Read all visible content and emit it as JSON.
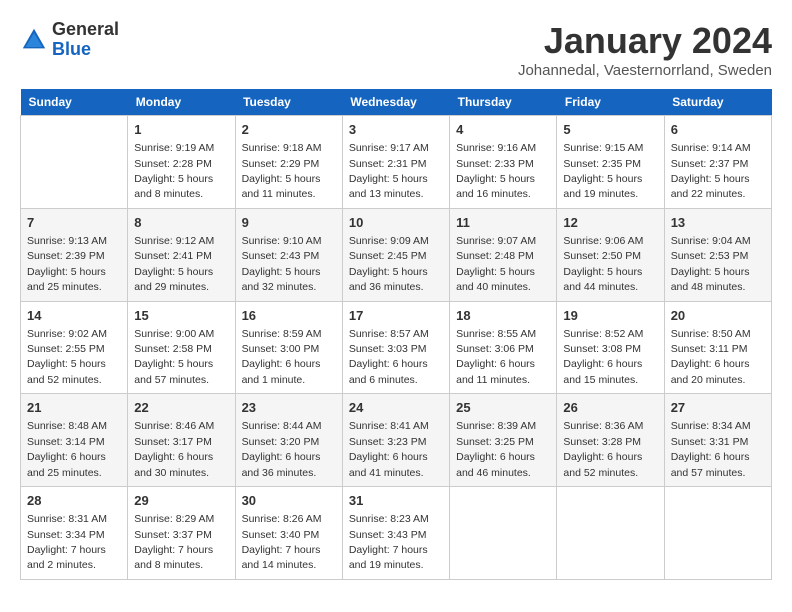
{
  "header": {
    "logo_general": "General",
    "logo_blue": "Blue",
    "month_title": "January 2024",
    "subtitle": "Johannedal, Vaesternorrland, Sweden"
  },
  "weekdays": [
    "Sunday",
    "Monday",
    "Tuesday",
    "Wednesday",
    "Thursday",
    "Friday",
    "Saturday"
  ],
  "weeks": [
    [
      {
        "day": "",
        "sunrise": "",
        "sunset": "",
        "daylight": ""
      },
      {
        "day": "1",
        "sunrise": "Sunrise: 9:19 AM",
        "sunset": "Sunset: 2:28 PM",
        "daylight": "Daylight: 5 hours and 8 minutes."
      },
      {
        "day": "2",
        "sunrise": "Sunrise: 9:18 AM",
        "sunset": "Sunset: 2:29 PM",
        "daylight": "Daylight: 5 hours and 11 minutes."
      },
      {
        "day": "3",
        "sunrise": "Sunrise: 9:17 AM",
        "sunset": "Sunset: 2:31 PM",
        "daylight": "Daylight: 5 hours and 13 minutes."
      },
      {
        "day": "4",
        "sunrise": "Sunrise: 9:16 AM",
        "sunset": "Sunset: 2:33 PM",
        "daylight": "Daylight: 5 hours and 16 minutes."
      },
      {
        "day": "5",
        "sunrise": "Sunrise: 9:15 AM",
        "sunset": "Sunset: 2:35 PM",
        "daylight": "Daylight: 5 hours and 19 minutes."
      },
      {
        "day": "6",
        "sunrise": "Sunrise: 9:14 AM",
        "sunset": "Sunset: 2:37 PM",
        "daylight": "Daylight: 5 hours and 22 minutes."
      }
    ],
    [
      {
        "day": "7",
        "sunrise": "Sunrise: 9:13 AM",
        "sunset": "Sunset: 2:39 PM",
        "daylight": "Daylight: 5 hours and 25 minutes."
      },
      {
        "day": "8",
        "sunrise": "Sunrise: 9:12 AM",
        "sunset": "Sunset: 2:41 PM",
        "daylight": "Daylight: 5 hours and 29 minutes."
      },
      {
        "day": "9",
        "sunrise": "Sunrise: 9:10 AM",
        "sunset": "Sunset: 2:43 PM",
        "daylight": "Daylight: 5 hours and 32 minutes."
      },
      {
        "day": "10",
        "sunrise": "Sunrise: 9:09 AM",
        "sunset": "Sunset: 2:45 PM",
        "daylight": "Daylight: 5 hours and 36 minutes."
      },
      {
        "day": "11",
        "sunrise": "Sunrise: 9:07 AM",
        "sunset": "Sunset: 2:48 PM",
        "daylight": "Daylight: 5 hours and 40 minutes."
      },
      {
        "day": "12",
        "sunrise": "Sunrise: 9:06 AM",
        "sunset": "Sunset: 2:50 PM",
        "daylight": "Daylight: 5 hours and 44 minutes."
      },
      {
        "day": "13",
        "sunrise": "Sunrise: 9:04 AM",
        "sunset": "Sunset: 2:53 PM",
        "daylight": "Daylight: 5 hours and 48 minutes."
      }
    ],
    [
      {
        "day": "14",
        "sunrise": "Sunrise: 9:02 AM",
        "sunset": "Sunset: 2:55 PM",
        "daylight": "Daylight: 5 hours and 52 minutes."
      },
      {
        "day": "15",
        "sunrise": "Sunrise: 9:00 AM",
        "sunset": "Sunset: 2:58 PM",
        "daylight": "Daylight: 5 hours and 57 minutes."
      },
      {
        "day": "16",
        "sunrise": "Sunrise: 8:59 AM",
        "sunset": "Sunset: 3:00 PM",
        "daylight": "Daylight: 6 hours and 1 minute."
      },
      {
        "day": "17",
        "sunrise": "Sunrise: 8:57 AM",
        "sunset": "Sunset: 3:03 PM",
        "daylight": "Daylight: 6 hours and 6 minutes."
      },
      {
        "day": "18",
        "sunrise": "Sunrise: 8:55 AM",
        "sunset": "Sunset: 3:06 PM",
        "daylight": "Daylight: 6 hours and 11 minutes."
      },
      {
        "day": "19",
        "sunrise": "Sunrise: 8:52 AM",
        "sunset": "Sunset: 3:08 PM",
        "daylight": "Daylight: 6 hours and 15 minutes."
      },
      {
        "day": "20",
        "sunrise": "Sunrise: 8:50 AM",
        "sunset": "Sunset: 3:11 PM",
        "daylight": "Daylight: 6 hours and 20 minutes."
      }
    ],
    [
      {
        "day": "21",
        "sunrise": "Sunrise: 8:48 AM",
        "sunset": "Sunset: 3:14 PM",
        "daylight": "Daylight: 6 hours and 25 minutes."
      },
      {
        "day": "22",
        "sunrise": "Sunrise: 8:46 AM",
        "sunset": "Sunset: 3:17 PM",
        "daylight": "Daylight: 6 hours and 30 minutes."
      },
      {
        "day": "23",
        "sunrise": "Sunrise: 8:44 AM",
        "sunset": "Sunset: 3:20 PM",
        "daylight": "Daylight: 6 hours and 36 minutes."
      },
      {
        "day": "24",
        "sunrise": "Sunrise: 8:41 AM",
        "sunset": "Sunset: 3:23 PM",
        "daylight": "Daylight: 6 hours and 41 minutes."
      },
      {
        "day": "25",
        "sunrise": "Sunrise: 8:39 AM",
        "sunset": "Sunset: 3:25 PM",
        "daylight": "Daylight: 6 hours and 46 minutes."
      },
      {
        "day": "26",
        "sunrise": "Sunrise: 8:36 AM",
        "sunset": "Sunset: 3:28 PM",
        "daylight": "Daylight: 6 hours and 52 minutes."
      },
      {
        "day": "27",
        "sunrise": "Sunrise: 8:34 AM",
        "sunset": "Sunset: 3:31 PM",
        "daylight": "Daylight: 6 hours and 57 minutes."
      }
    ],
    [
      {
        "day": "28",
        "sunrise": "Sunrise: 8:31 AM",
        "sunset": "Sunset: 3:34 PM",
        "daylight": "Daylight: 7 hours and 2 minutes."
      },
      {
        "day": "29",
        "sunrise": "Sunrise: 8:29 AM",
        "sunset": "Sunset: 3:37 PM",
        "daylight": "Daylight: 7 hours and 8 minutes."
      },
      {
        "day": "30",
        "sunrise": "Sunrise: 8:26 AM",
        "sunset": "Sunset: 3:40 PM",
        "daylight": "Daylight: 7 hours and 14 minutes."
      },
      {
        "day": "31",
        "sunrise": "Sunrise: 8:23 AM",
        "sunset": "Sunset: 3:43 PM",
        "daylight": "Daylight: 7 hours and 19 minutes."
      },
      {
        "day": "",
        "sunrise": "",
        "sunset": "",
        "daylight": ""
      },
      {
        "day": "",
        "sunrise": "",
        "sunset": "",
        "daylight": ""
      },
      {
        "day": "",
        "sunrise": "",
        "sunset": "",
        "daylight": ""
      }
    ]
  ]
}
